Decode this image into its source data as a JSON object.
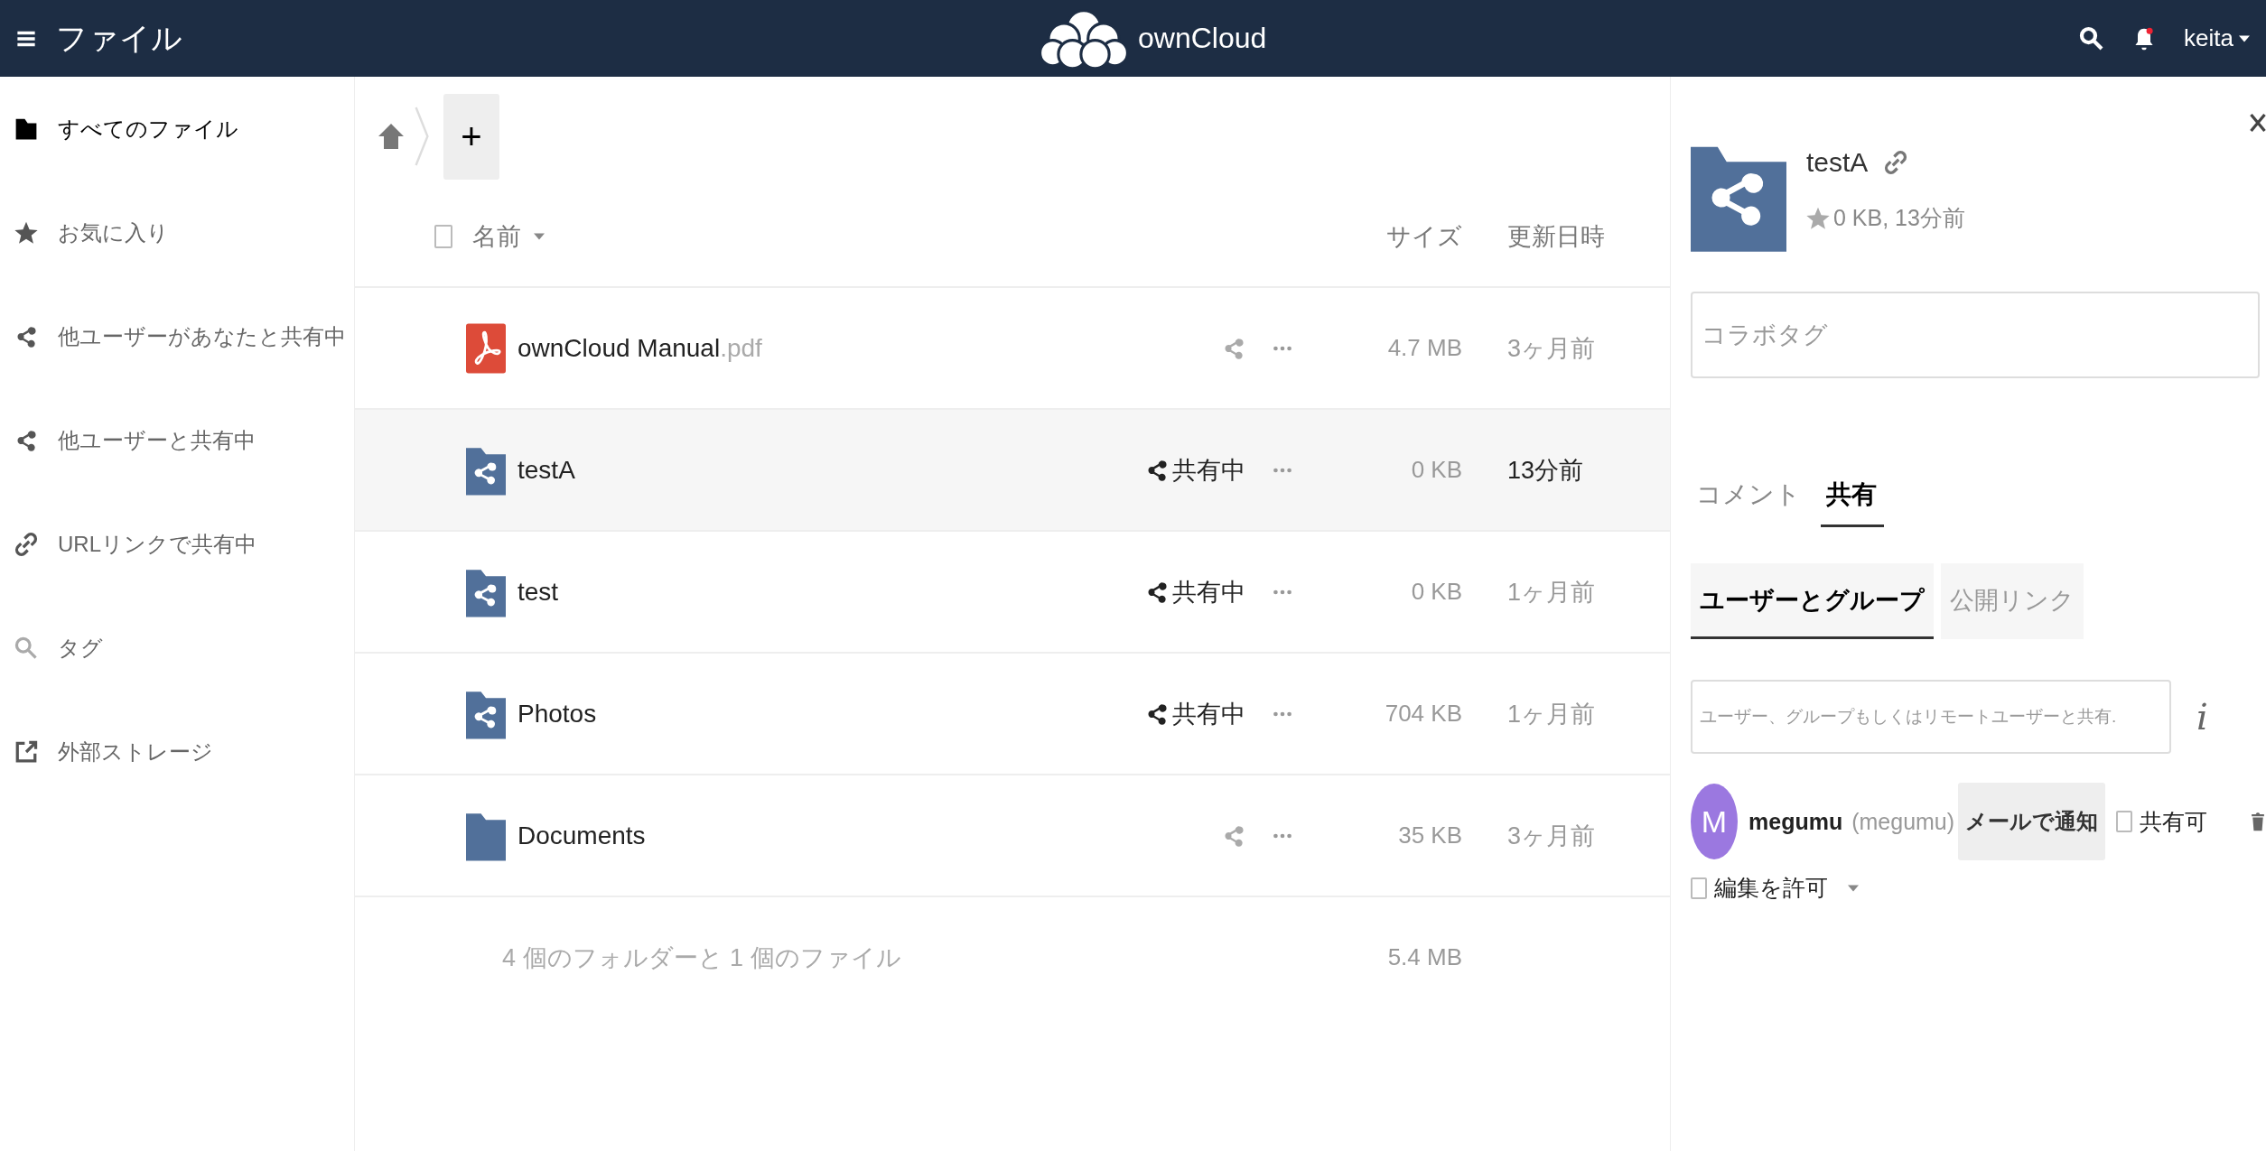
{
  "header": {
    "title": "ファイル",
    "brand": "ownCloud",
    "user": "keita"
  },
  "sidebar": {
    "items": [
      {
        "label": "すべてのファイル",
        "selected": true
      },
      {
        "label": "お気に入り",
        "selected": false
      },
      {
        "label": "他ユーザーがあなたと共有中",
        "selected": false
      },
      {
        "label": "他ユーザーと共有中",
        "selected": false
      },
      {
        "label": "URLリンクで共有中",
        "selected": false
      },
      {
        "label": "タグ",
        "selected": false
      },
      {
        "label": "外部ストレージ",
        "selected": false
      }
    ]
  },
  "breadcrumb": {
    "new_button": "+"
  },
  "table": {
    "select_all": {
      "checked": false
    },
    "columns": {
      "name": "名前",
      "size": "サイズ",
      "modified": "更新日時"
    },
    "rows": [
      {
        "kind": "pdf",
        "name": "ownCloud Manual",
        "extension": ".pdf",
        "shared": false,
        "size": "4.7 MB",
        "modified": "3ヶ月前",
        "selected": false
      },
      {
        "kind": "shared-folder",
        "name": "testA",
        "shared": true,
        "share_label": "共有中",
        "size": "0 KB",
        "modified": "13分前",
        "selected": true
      },
      {
        "kind": "shared-folder",
        "name": "test",
        "shared": true,
        "share_label": "共有中",
        "size": "0 KB",
        "modified": "1ヶ月前",
        "selected": false
      },
      {
        "kind": "shared-folder",
        "name": "Photos",
        "shared": true,
        "share_label": "共有中",
        "size": "704 KB",
        "modified": "1ヶ月前",
        "selected": false
      },
      {
        "kind": "folder",
        "name": "Documents",
        "shared": false,
        "size": "35 KB",
        "modified": "3ヶ月前",
        "selected": false
      }
    ],
    "summary": {
      "text": "4 個のフォルダーと 1 個のファイル",
      "size": "5.4 MB"
    }
  },
  "details": {
    "name": "testA",
    "favorite": false,
    "meta": "0 KB, 13分前",
    "tags_placeholder": "コラボタグ",
    "tabs": [
      {
        "label": "コメント",
        "selected": false
      },
      {
        "label": "共有",
        "selected": true
      }
    ],
    "subtabs": [
      {
        "label": "ユーザーとグループ",
        "selected": true
      },
      {
        "label": "公開リンク",
        "selected": false
      }
    ],
    "share_placeholder": "ユーザー、グループもしくはリモートユーザーと共有.",
    "info_icon": "i",
    "shares": [
      {
        "initial": "M",
        "color": "#9b78e0",
        "name": "megumu",
        "id": "(megumu)",
        "notify": "メールで通知",
        "can_share": {
          "label": "共有可",
          "checked": false
        },
        "can_edit": {
          "label": "編集を許可",
          "checked": false
        }
      }
    ]
  }
}
